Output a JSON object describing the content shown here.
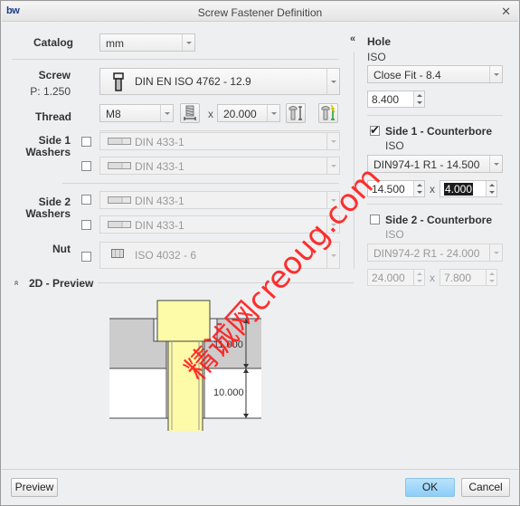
{
  "window": {
    "logo": "bw",
    "title": "Screw Fastener Definition",
    "close_glyph": "✕"
  },
  "catalog": {
    "label": "Catalog",
    "value": "mm"
  },
  "screw": {
    "label": "Screw",
    "pitch": "P: 1.250",
    "value": "DIN EN ISO 4762 - 12.9"
  },
  "thread": {
    "label": "Thread",
    "size": "M8",
    "times": "x",
    "length": "20.000"
  },
  "side1_washers": {
    "label_line1": "Side 1",
    "label_line2": "Washers",
    "items": [
      {
        "checked": false,
        "value": "DIN 433-1"
      },
      {
        "checked": false,
        "value": "DIN 433-1"
      }
    ]
  },
  "side2_washers": {
    "label_line1": "Side 2",
    "label_line2": "Washers",
    "items": [
      {
        "checked": false,
        "value": "DIN 433-1"
      },
      {
        "checked": false,
        "value": "DIN 433-1"
      }
    ]
  },
  "nut": {
    "label": "Nut",
    "checked": false,
    "value": "ISO 4032 - 6"
  },
  "preview_section": {
    "collapse_glyph": "»",
    "label": "2D - Preview",
    "dim_upper": "11.000",
    "dim_lower": "10.000"
  },
  "hole": {
    "collapse_glyph": "«",
    "label": "Hole",
    "standard": "ISO",
    "fit": "Close Fit - 8.4",
    "diameter": "8.400"
  },
  "side1_counterbore": {
    "label": "Side 1 - Counterbore",
    "checked": true,
    "standard": "ISO",
    "value": "DIN974-1 R1 - 14.500",
    "diameter": "14.500",
    "times": "x",
    "depth": "4.000"
  },
  "side2_counterbore": {
    "label": "Side 2 - Counterbore",
    "checked": false,
    "standard": "ISO",
    "value": "DIN974-2 R1 - 24.000",
    "diameter": "24.000",
    "times": "x",
    "depth": "7.800"
  },
  "footer": {
    "preview_label": "Preview",
    "ok_label": "OK",
    "cancel_label": "Cancel"
  },
  "watermark": "精诚网creoug.com",
  "colors": {
    "screw_fill": "#fdfaa8",
    "plate_upper": "#cccccc",
    "ok_button": "#9fd6f8",
    "watermark": "#ff1a1a"
  }
}
